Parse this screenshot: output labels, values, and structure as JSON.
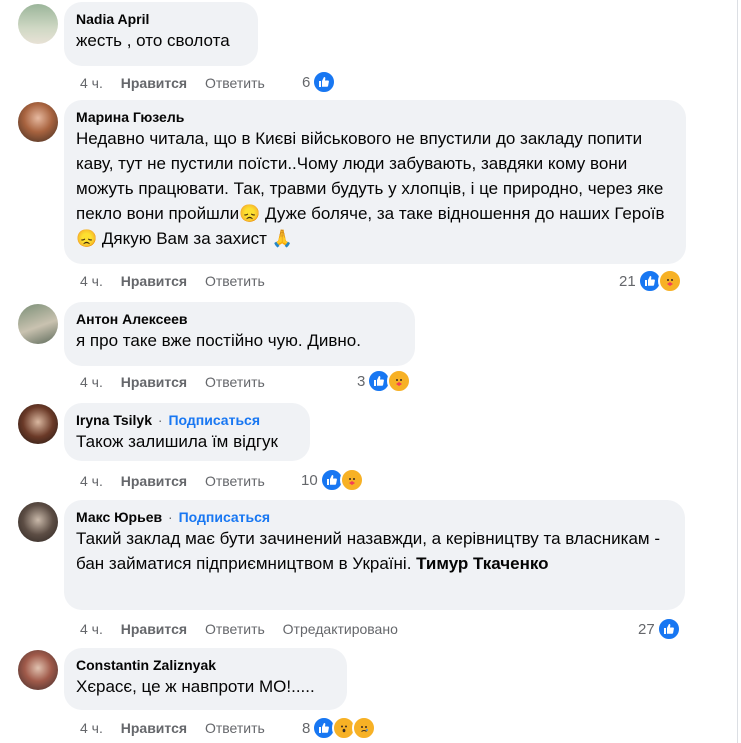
{
  "comments": [
    {
      "author": "Nadia April",
      "subscribe": "",
      "text": "жесть , ото сволота",
      "time": "4 ч.",
      "like": "Нравится",
      "reply": "Ответить",
      "edited": "",
      "reactions_count": "6",
      "reactions": [
        "like"
      ]
    },
    {
      "author": "Марина Гюзель",
      "subscribe": "",
      "text": "Недавно читала, що в Києві військового не впустили до закладу попити каву, тут не пустили поїсти..Чому люди забувають, завдяки кому вони можуть працювати. Так, травми будуть у хлопців, і це природно, через яке пекло вони пройшли😞 Дуже боляче, за таке відношення до наших Героїв😞 Дякую Вам за захист 🙏",
      "time": "4 ч.",
      "like": "Нравится",
      "reply": "Ответить",
      "edited": "",
      "reactions_count": "21",
      "reactions": [
        "like",
        "care"
      ]
    },
    {
      "author": "Антон Алексеев",
      "subscribe": "",
      "text": "я про таке вже постійно чую. Дивно.",
      "time": "4 ч.",
      "like": "Нравится",
      "reply": "Ответить",
      "edited": "",
      "reactions_count": "3",
      "reactions": [
        "like",
        "care"
      ]
    },
    {
      "author": "Iryna Tsilyk",
      "subscribe": "Подписаться",
      "text": "Також залишила їм відгук",
      "time": "4 ч.",
      "like": "Нравится",
      "reply": "Ответить",
      "edited": "",
      "reactions_count": "10",
      "reactions": [
        "like",
        "care"
      ]
    },
    {
      "author": "Макс Юрьев",
      "subscribe": "Подписаться",
      "text": "Такий заклад має бути зачинений назавжди, а керівництву та власникам - бан займатися підприємництвом в Україні.",
      "mention": "Тимур Ткаченко",
      "time": "4 ч.",
      "like": "Нравится",
      "reply": "Ответить",
      "edited": "Отредактировано",
      "reactions_count": "27",
      "reactions": [
        "like"
      ]
    },
    {
      "author": "Constantin Zaliznyak",
      "subscribe": "",
      "text": "Хєрасє, це ж навпроти МО!.....",
      "time": "4 ч.",
      "like": "Нравится",
      "reply": "Ответить",
      "edited": "",
      "reactions_count": "8",
      "reactions": [
        "like",
        "wow",
        "sad"
      ]
    }
  ],
  "dot": "·",
  "colors": {
    "bubble": "#f0f2f5",
    "link": "#1877f2",
    "meta": "#65676b",
    "like_icon": "#1877f2"
  }
}
